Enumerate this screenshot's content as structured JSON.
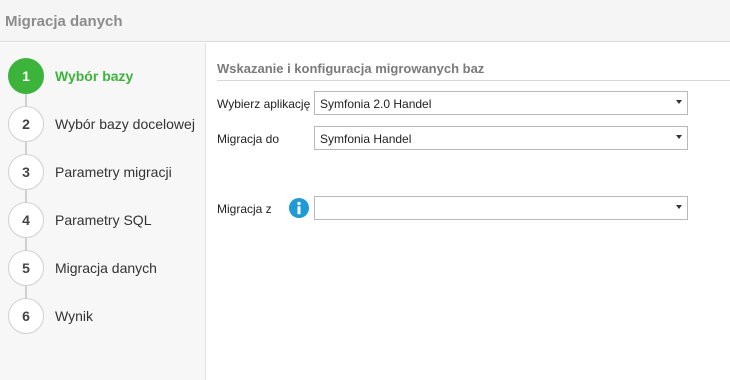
{
  "header": {
    "title": "Migracja danych"
  },
  "steps": [
    {
      "number": "1",
      "label": "Wybór bazy",
      "active": true
    },
    {
      "number": "2",
      "label": "Wybór bazy docelowej",
      "active": false
    },
    {
      "number": "3",
      "label": "Parametry migracji",
      "active": false
    },
    {
      "number": "4",
      "label": "Parametry SQL",
      "active": false
    },
    {
      "number": "5",
      "label": "Migracja danych",
      "active": false
    },
    {
      "number": "6",
      "label": "Wynik",
      "active": false
    }
  ],
  "main": {
    "section_title": "Wskazanie i konfiguracja migrowanych baz",
    "fields": {
      "application": {
        "label": "Wybierz aplikację",
        "value": "Symfonia 2.0 Handel"
      },
      "migration_to": {
        "label": "Migracja do",
        "value": "Symfonia Handel"
      },
      "migration_from": {
        "label": "Migracja z",
        "value": ""
      }
    }
  },
  "colors": {
    "active_step": "#3cb43c",
    "info_icon": "#1e9ad6",
    "header_text": "#8c8c8c"
  },
  "icons": {
    "info": "info-icon",
    "dropdown": "chevron-down-icon"
  }
}
